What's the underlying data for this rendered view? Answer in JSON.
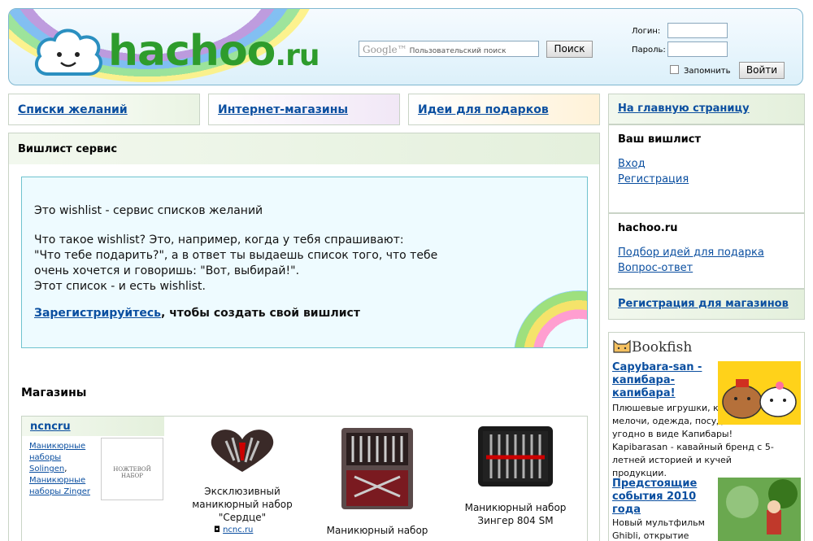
{
  "header": {
    "logo_main": "hachoo",
    "logo_suffix": ".ru",
    "search_google": "Google™",
    "search_placeholder": "Пользовательский поиск",
    "search_button": "Поиск",
    "login_label": "Логин:",
    "password_label": "Пароль:",
    "remember_label": "Запомнить",
    "login_button": "Войти"
  },
  "nav": {
    "wishlists": "Списки желаний",
    "shops": "Интернет-магазины",
    "ideas": "Идеи для подарков"
  },
  "main": {
    "heading": "Вишлист сервис",
    "intro_title": "Это wishlist - сервис списков желаний",
    "intro_line1": "Что такое wishlist? Это, например, когда у тебя спрашивают:",
    "intro_line2": "\"Что тебе подарить?\", а в ответ ты выдаешь список того, что тебе",
    "intro_line3": "очень хочется и говоришь: \"Вот, выбирай!\".",
    "intro_line4": "Этот список - и есть wishlist.",
    "cta_link": "Зарегистрируйтесь",
    "cta_rest": ", чтобы создать свой вишлист",
    "shops_title": "Магазины"
  },
  "shop": {
    "name": "ncncru",
    "links": [
      "Маникюрные наборы Solingen",
      ",",
      "Маникюрные наборы Zinger"
    ],
    "logo_text": "НОЖТЕВОЙ НАБОР",
    "site": "ncnc.ru",
    "products": [
      {
        "name": "Эксклюзивный маникюрный набор \"Сердце\""
      },
      {
        "name": "Маникюрный набор"
      },
      {
        "name": "Маникюрный набор Зингер 804 SM"
      }
    ]
  },
  "sidebar": {
    "home": "На главную страницу",
    "wishlist_heading": "Ваш вишлист",
    "login_link": "Вход",
    "register_link": "Регистрация",
    "hachoo_heading": "hachoo.ru",
    "ideas_link": "Подбор идей для подарка",
    "faq_link": "Вопрос-ответ",
    "shop_register": "Регистрация для магазинов"
  },
  "bookfish": {
    "logo": "Bookfish",
    "items": [
      {
        "title": "Capybara-san - капибара-капибара!",
        "text": "Плюшевые игрушки, канцелярские мелочи, одежда, посуда - все что угодно в виде Капибары! Kapibarasan - кавайный бренд с 5-летней историей и кучей продукции."
      },
      {
        "title": "Предстоящие события 2010 года",
        "text": "Новый мультфильм Ghibli, открытие"
      }
    ]
  },
  "colors": {
    "link": "#0b4fa0",
    "logo_green": "#2e9c2c",
    "header_border": "#7fb7d0",
    "panel_green": "#e4f0dc"
  }
}
